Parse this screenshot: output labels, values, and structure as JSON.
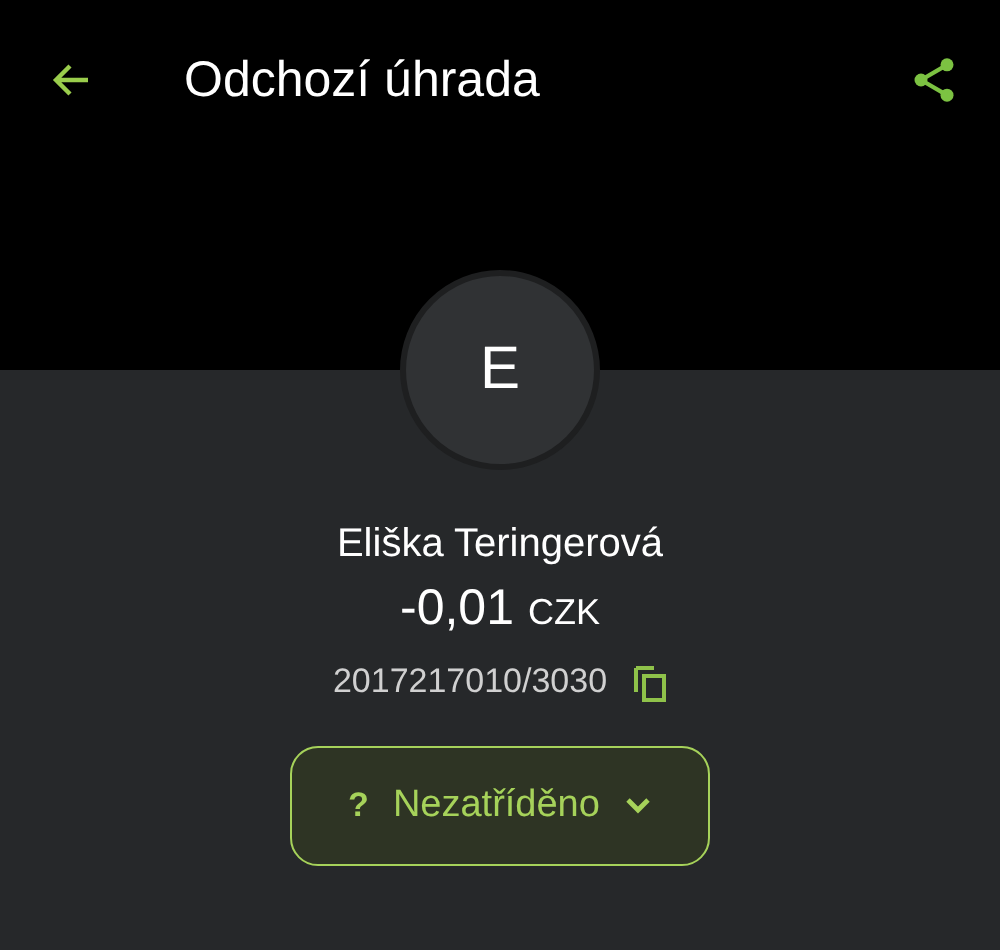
{
  "header": {
    "title": "Odchozí úhrada"
  },
  "contact": {
    "initial": "E",
    "name": "Eliška Teringerová"
  },
  "amount": {
    "value": "-0,01",
    "currency": "CZK"
  },
  "account": {
    "number": "2017217010/3030"
  },
  "category": {
    "symbol": "?",
    "label": "Nezatříděno"
  }
}
